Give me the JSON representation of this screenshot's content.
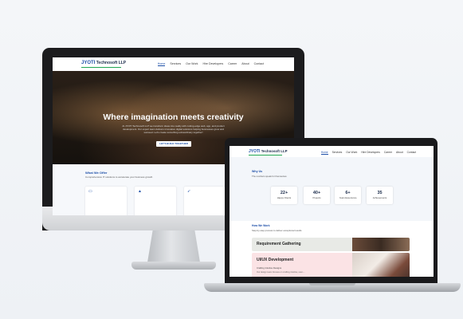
{
  "desktop": {
    "logo": {
      "brand": "JYOTI",
      "suffix": "Technosoft LLP"
    },
    "nav": [
      "Home",
      "Services",
      "Our Work",
      "Hire Developers",
      "Career",
      "About",
      "Contact"
    ],
    "hero": {
      "title": "Where imagination meets creativity",
      "subtitle": "At JYOTI Technosoft LLP we transform ideas into reality with cutting-edge web, app, and product development. Our expert team delivers innovative digital solutions helping businesses grow and succeed. Let's create something extraordinary together!",
      "cta": "LET'S BUILD TOGETHER"
    },
    "offer": {
      "heading": "What We Offer",
      "subheading": "Comprehensive IT solutions to accelerate your business growth"
    }
  },
  "laptop": {
    "logo": {
      "brand": "JYOTI",
      "suffix": "Technosoft LLP"
    },
    "nav": [
      "Home",
      "Services",
      "Our Work",
      "Hire Developers",
      "Career",
      "About",
      "Contact"
    ],
    "why": {
      "heading": "Why Us",
      "subheading": "The numbers speak for themselves",
      "stats": [
        {
          "value": "22+",
          "label": "Happy Clients"
        },
        {
          "value": "40+",
          "label": "Projects"
        },
        {
          "value": "6+",
          "label": "Years Experience"
        },
        {
          "value": "35",
          "label": "Achievements"
        }
      ]
    },
    "how": {
      "heading": "How We Work",
      "subheading": "Step-by-step process to deliver exceptional results",
      "steps": [
        {
          "title": "Requirement Gathering"
        },
        {
          "title": "UI/UX Development",
          "desc1": "Crafting Intuitive Designs",
          "desc2": "Our design team focuses on crafting intuitive, user-..."
        }
      ]
    }
  }
}
